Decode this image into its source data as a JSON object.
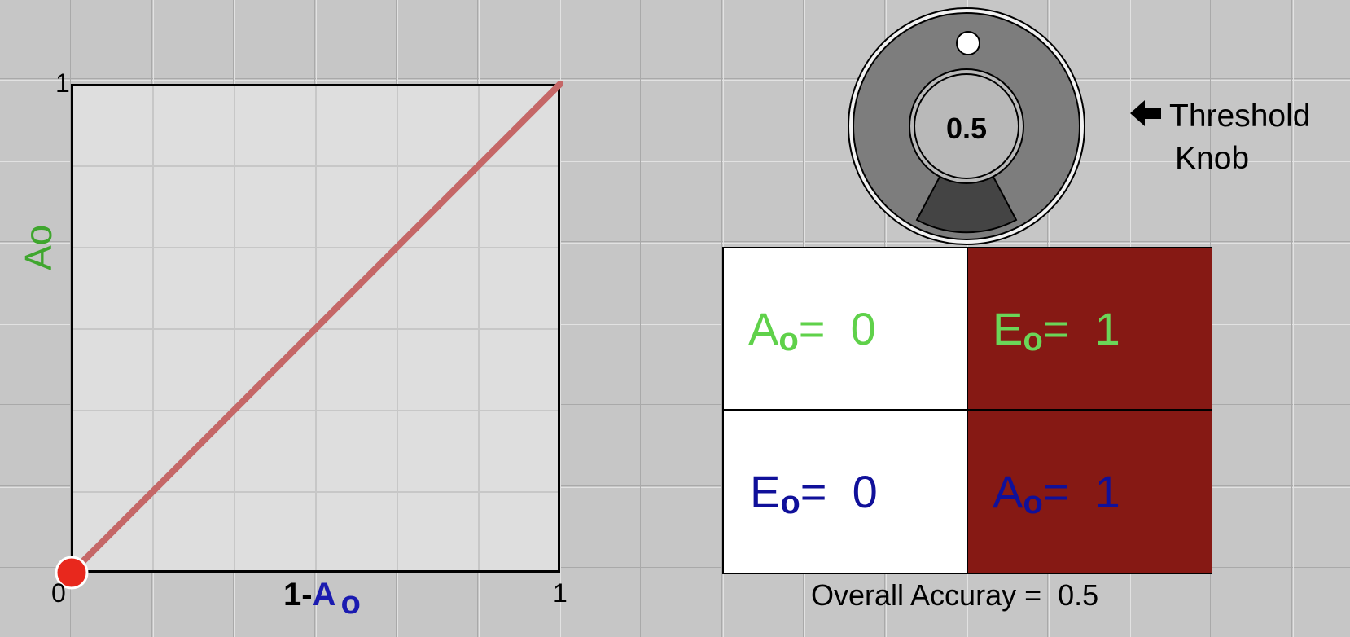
{
  "plot": {
    "y_axis_label": "Ao",
    "x_axis_label_prefix": "1-",
    "x_axis_label_var": "A",
    "x_axis_label_sub": "o",
    "tick_origin": "0",
    "tick_x_max": "1",
    "tick_y_max": "1",
    "line_color": "#c56767",
    "point_color": "#e8281d",
    "point_fpr": 0,
    "point_tpr": 0
  },
  "knob": {
    "value": "0.5",
    "label_line1": "Threshold",
    "label_line2": "Knob",
    "arrow_icon": "left-arrow-icon"
  },
  "matrix": {
    "top_left": {
      "var": "A",
      "sub": "o",
      "value": "=  0"
    },
    "top_right": {
      "var": "E",
      "sub": "o",
      "value": "=  1"
    },
    "bottom_left": {
      "var": "E",
      "sub": "o",
      "value": "=  0"
    },
    "bottom_right": {
      "var": "A",
      "sub": "o",
      "value": "=  1"
    },
    "colors": {
      "white": "#ffffff",
      "red": "#861914",
      "green": "#5fd14a",
      "blue": "#10109a"
    }
  },
  "accuracy_text": "Overall Accuray =  0.5"
}
